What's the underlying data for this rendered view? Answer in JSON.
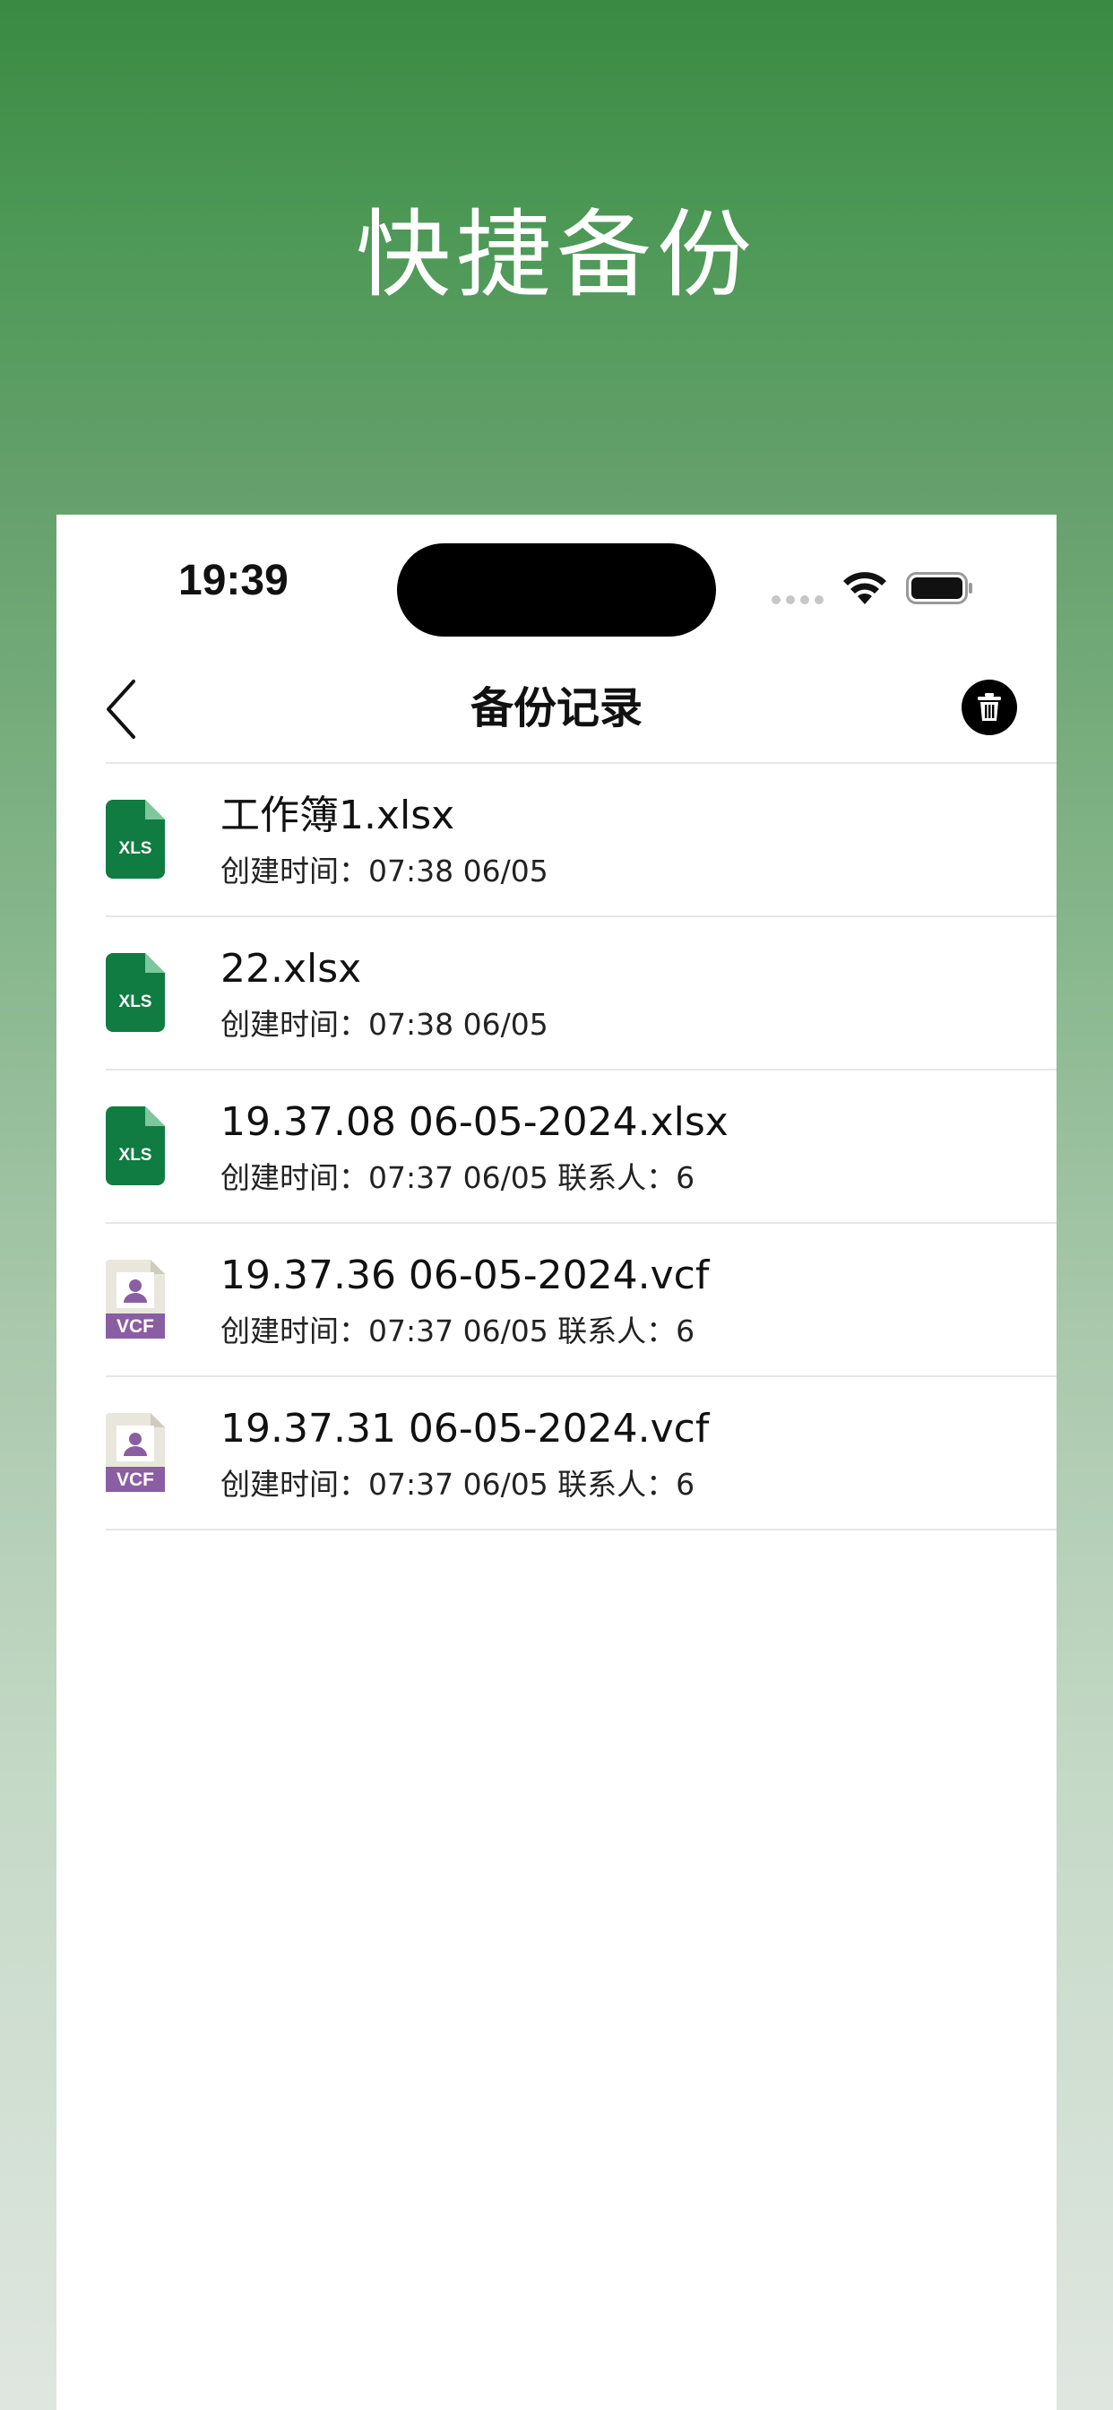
{
  "promo": {
    "title": "快捷备份"
  },
  "status_bar": {
    "time": "19:39"
  },
  "nav": {
    "title": "备份记录",
    "back_icon": "chevron-left-icon",
    "trash_icon": "trash-icon"
  },
  "colors": {
    "xls_green": "#107c41",
    "vcf_purple": "#8a5ea3",
    "vcf_paper": "#e9e7dc"
  },
  "files": [
    {
      "type": "xls",
      "icon_text": "XLS",
      "name": "工作簿1.xlsx",
      "meta": "创建时间：07:38 06/05"
    },
    {
      "type": "xls",
      "icon_text": "XLS",
      "name": "22.xlsx",
      "meta": "创建时间：07:38 06/05"
    },
    {
      "type": "xls",
      "icon_text": "XLS",
      "name": "19.37.08 06-05-2024.xlsx",
      "meta": "创建时间：07:37 06/05 联系人：6"
    },
    {
      "type": "vcf",
      "icon_text": "VCF",
      "name": "19.37.36 06-05-2024.vcf",
      "meta": "创建时间：07:37 06/05 联系人：6"
    },
    {
      "type": "vcf",
      "icon_text": "VCF",
      "name": "19.37.31 06-05-2024.vcf",
      "meta": "创建时间：07:37 06/05 联系人：6"
    }
  ]
}
